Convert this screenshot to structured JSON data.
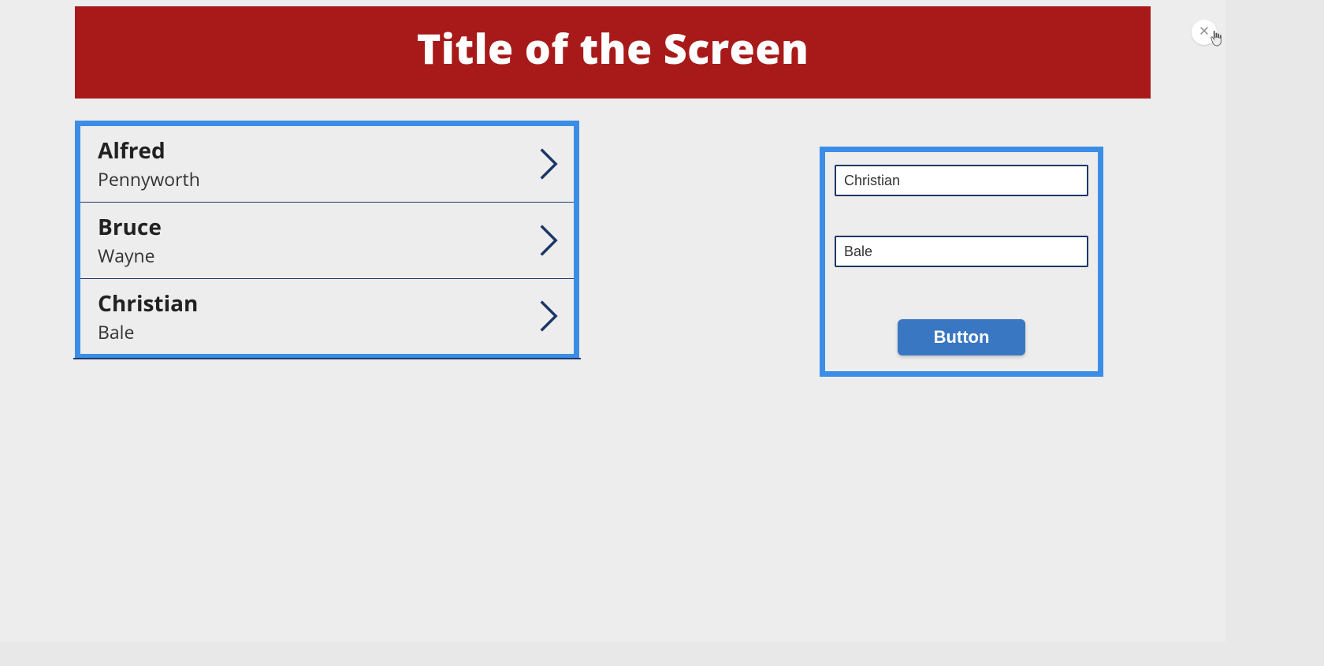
{
  "header": {
    "title": "Title of the Screen"
  },
  "list": {
    "items": [
      {
        "first": "Alfred",
        "last": "Pennyworth"
      },
      {
        "first": "Bruce",
        "last": "Wayne"
      },
      {
        "first": "Christian",
        "last": "Bale"
      }
    ]
  },
  "form": {
    "field1_value": "Christian",
    "field2_value": "Bale",
    "button_label": "Button"
  },
  "colors": {
    "header_bg": "#a81a1a",
    "highlight_border": "#3b8de6",
    "input_border": "#1b3766",
    "button_bg": "#3a77c2"
  }
}
